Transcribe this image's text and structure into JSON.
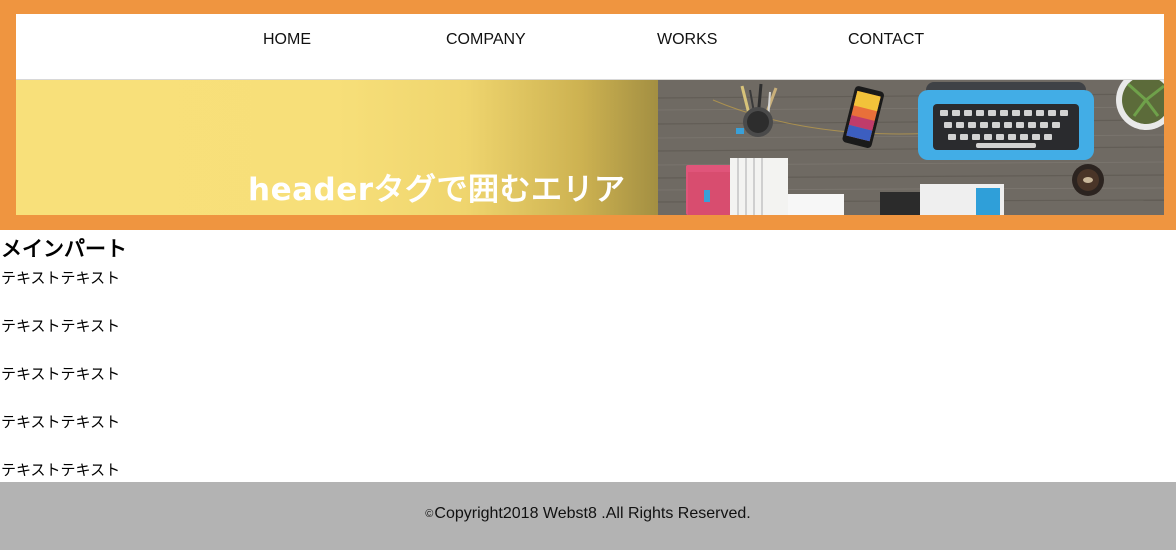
{
  "nav": {
    "items": [
      {
        "label": "HOME"
      },
      {
        "label": "COMPANY"
      },
      {
        "label": "WORKS"
      },
      {
        "label": "CONTACT"
      }
    ]
  },
  "hero": {
    "title": "headerタグで囲むエリア",
    "colors": {
      "frame": "#ef9540",
      "yellow": "#f8e07a"
    }
  },
  "main": {
    "heading": "メインパート",
    "paragraphs": [
      "テキストテキスト",
      "テキストテキスト",
      "テキストテキスト",
      "テキストテキスト",
      "テキストテキスト"
    ]
  },
  "footer": {
    "copyright_mark": "©",
    "copyright_text": "Copyright2018 Webst8 .All Rights Reserved.",
    "background": "#b3b3b3"
  }
}
